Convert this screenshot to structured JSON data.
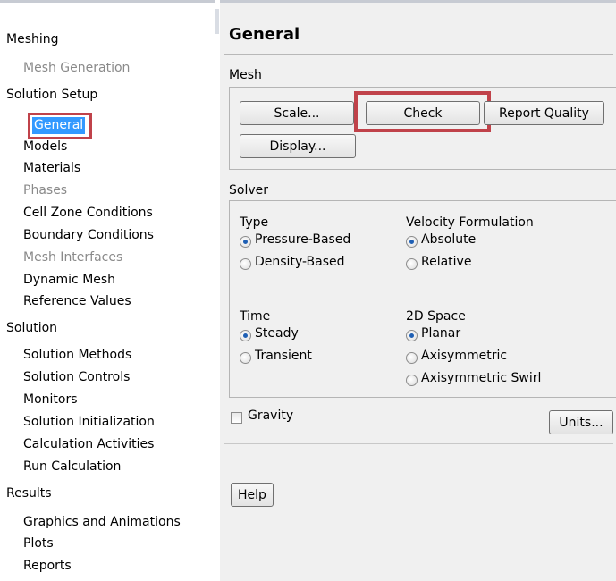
{
  "tree": {
    "sections": [
      {
        "label": "Meshing",
        "items": [
          {
            "label": "Mesh Generation",
            "disabled": true
          }
        ]
      },
      {
        "label": "Solution Setup",
        "items": [
          {
            "label": "General",
            "selected": true
          },
          {
            "label": "Models"
          },
          {
            "label": "Materials"
          },
          {
            "label": "Phases",
            "disabled": true
          },
          {
            "label": "Cell Zone Conditions"
          },
          {
            "label": "Boundary Conditions"
          },
          {
            "label": "Mesh Interfaces",
            "disabled": true
          },
          {
            "label": "Dynamic Mesh"
          },
          {
            "label": "Reference Values"
          }
        ]
      },
      {
        "label": "Solution",
        "items": [
          {
            "label": "Solution Methods"
          },
          {
            "label": "Solution Controls"
          },
          {
            "label": "Monitors"
          },
          {
            "label": "Solution Initialization"
          },
          {
            "label": "Calculation Activities"
          },
          {
            "label": "Run Calculation"
          }
        ]
      },
      {
        "label": "Results",
        "items": [
          {
            "label": "Graphics and Animations"
          },
          {
            "label": "Plots"
          },
          {
            "label": "Reports"
          }
        ]
      }
    ]
  },
  "panel": {
    "title": "General",
    "mesh": {
      "label": "Mesh",
      "buttons": {
        "scale": "Scale...",
        "check": "Check",
        "report_quality": "Report Quality",
        "display": "Display..."
      }
    },
    "solver": {
      "label": "Solver",
      "type": {
        "label": "Type",
        "options": [
          {
            "label": "Pressure-Based",
            "selected": true
          },
          {
            "label": "Density-Based",
            "selected": false
          }
        ]
      },
      "velocity": {
        "label": "Velocity Formulation",
        "options": [
          {
            "label": "Absolute",
            "selected": true
          },
          {
            "label": "Relative",
            "selected": false
          }
        ]
      },
      "time": {
        "label": "Time",
        "options": [
          {
            "label": "Steady",
            "selected": true
          },
          {
            "label": "Transient",
            "selected": false
          }
        ]
      },
      "space": {
        "label": "2D Space",
        "options": [
          {
            "label": "Planar",
            "selected": true
          },
          {
            "label": "Axisymmetric",
            "selected": false
          },
          {
            "label": "Axisymmetric Swirl",
            "selected": false
          }
        ]
      }
    },
    "gravity": {
      "label": "Gravity",
      "checked": false
    },
    "units_button": "Units...",
    "help_button": "Help"
  },
  "colors": {
    "highlight": "#c0424a",
    "selection": "#3399ff",
    "radio_dot": "#1e5fb4"
  }
}
